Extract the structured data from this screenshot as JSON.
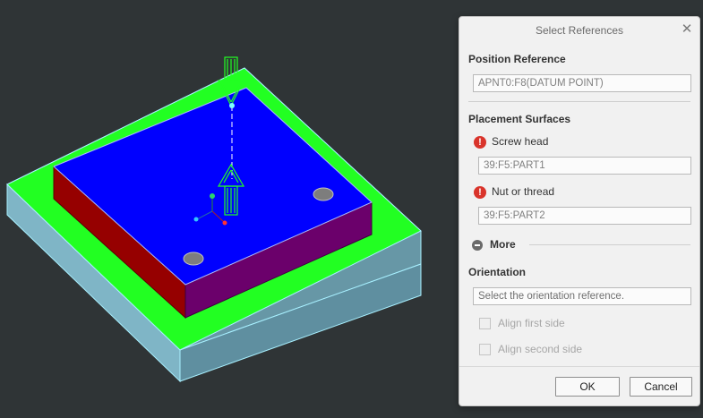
{
  "dialog": {
    "title": "Select References",
    "position_reference": {
      "heading": "Position Reference",
      "value": "APNT0:F8(DATUM POINT)"
    },
    "placement_surfaces": {
      "heading": "Placement Surfaces",
      "screw_head_label": "Screw head",
      "screw_head_value": "39:F5:PART1",
      "nut_label": "Nut or thread",
      "nut_value": "39:F5:PART2"
    },
    "more_label": "More",
    "orientation": {
      "heading": "Orientation",
      "placeholder": "Select the orientation reference.",
      "align_first": "Align first side",
      "align_second": "Align second side"
    },
    "ok_label": "OK",
    "cancel_label": "Cancel"
  },
  "icons": {
    "required": "exclamation-icon",
    "close": "close-icon",
    "collapse": "minus-icon"
  },
  "colors": {
    "background": "#2f3436",
    "base_plate": "#9ad3e6",
    "green_surface": "#22ff22",
    "top_face": "#0000ff",
    "front_face": "#960000",
    "side_face": "#6b006b",
    "required_icon": "#d9342b"
  }
}
